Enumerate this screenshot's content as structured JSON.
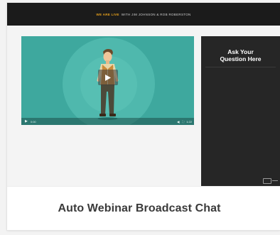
{
  "preview": {
    "banner_highlight": "WE ARE LIVE",
    "banner_text": "WITH JIM JOHNSON & ROB ROBERSTON",
    "video": {
      "elapsed": "0:00",
      "duration": "1:22"
    },
    "chat_title_line1": "Ask Your",
    "chat_title_line2": "Question Here"
  },
  "card": {
    "title": "Auto Webinar Broadcast Chat"
  },
  "colors": {
    "video_bg": "#3ea89e",
    "chat_bg": "#262626",
    "banner_highlight": "#e8a21c"
  },
  "icons": [
    "play-icon",
    "volume-icon",
    "fullscreen-icon",
    "chat-icon"
  ]
}
